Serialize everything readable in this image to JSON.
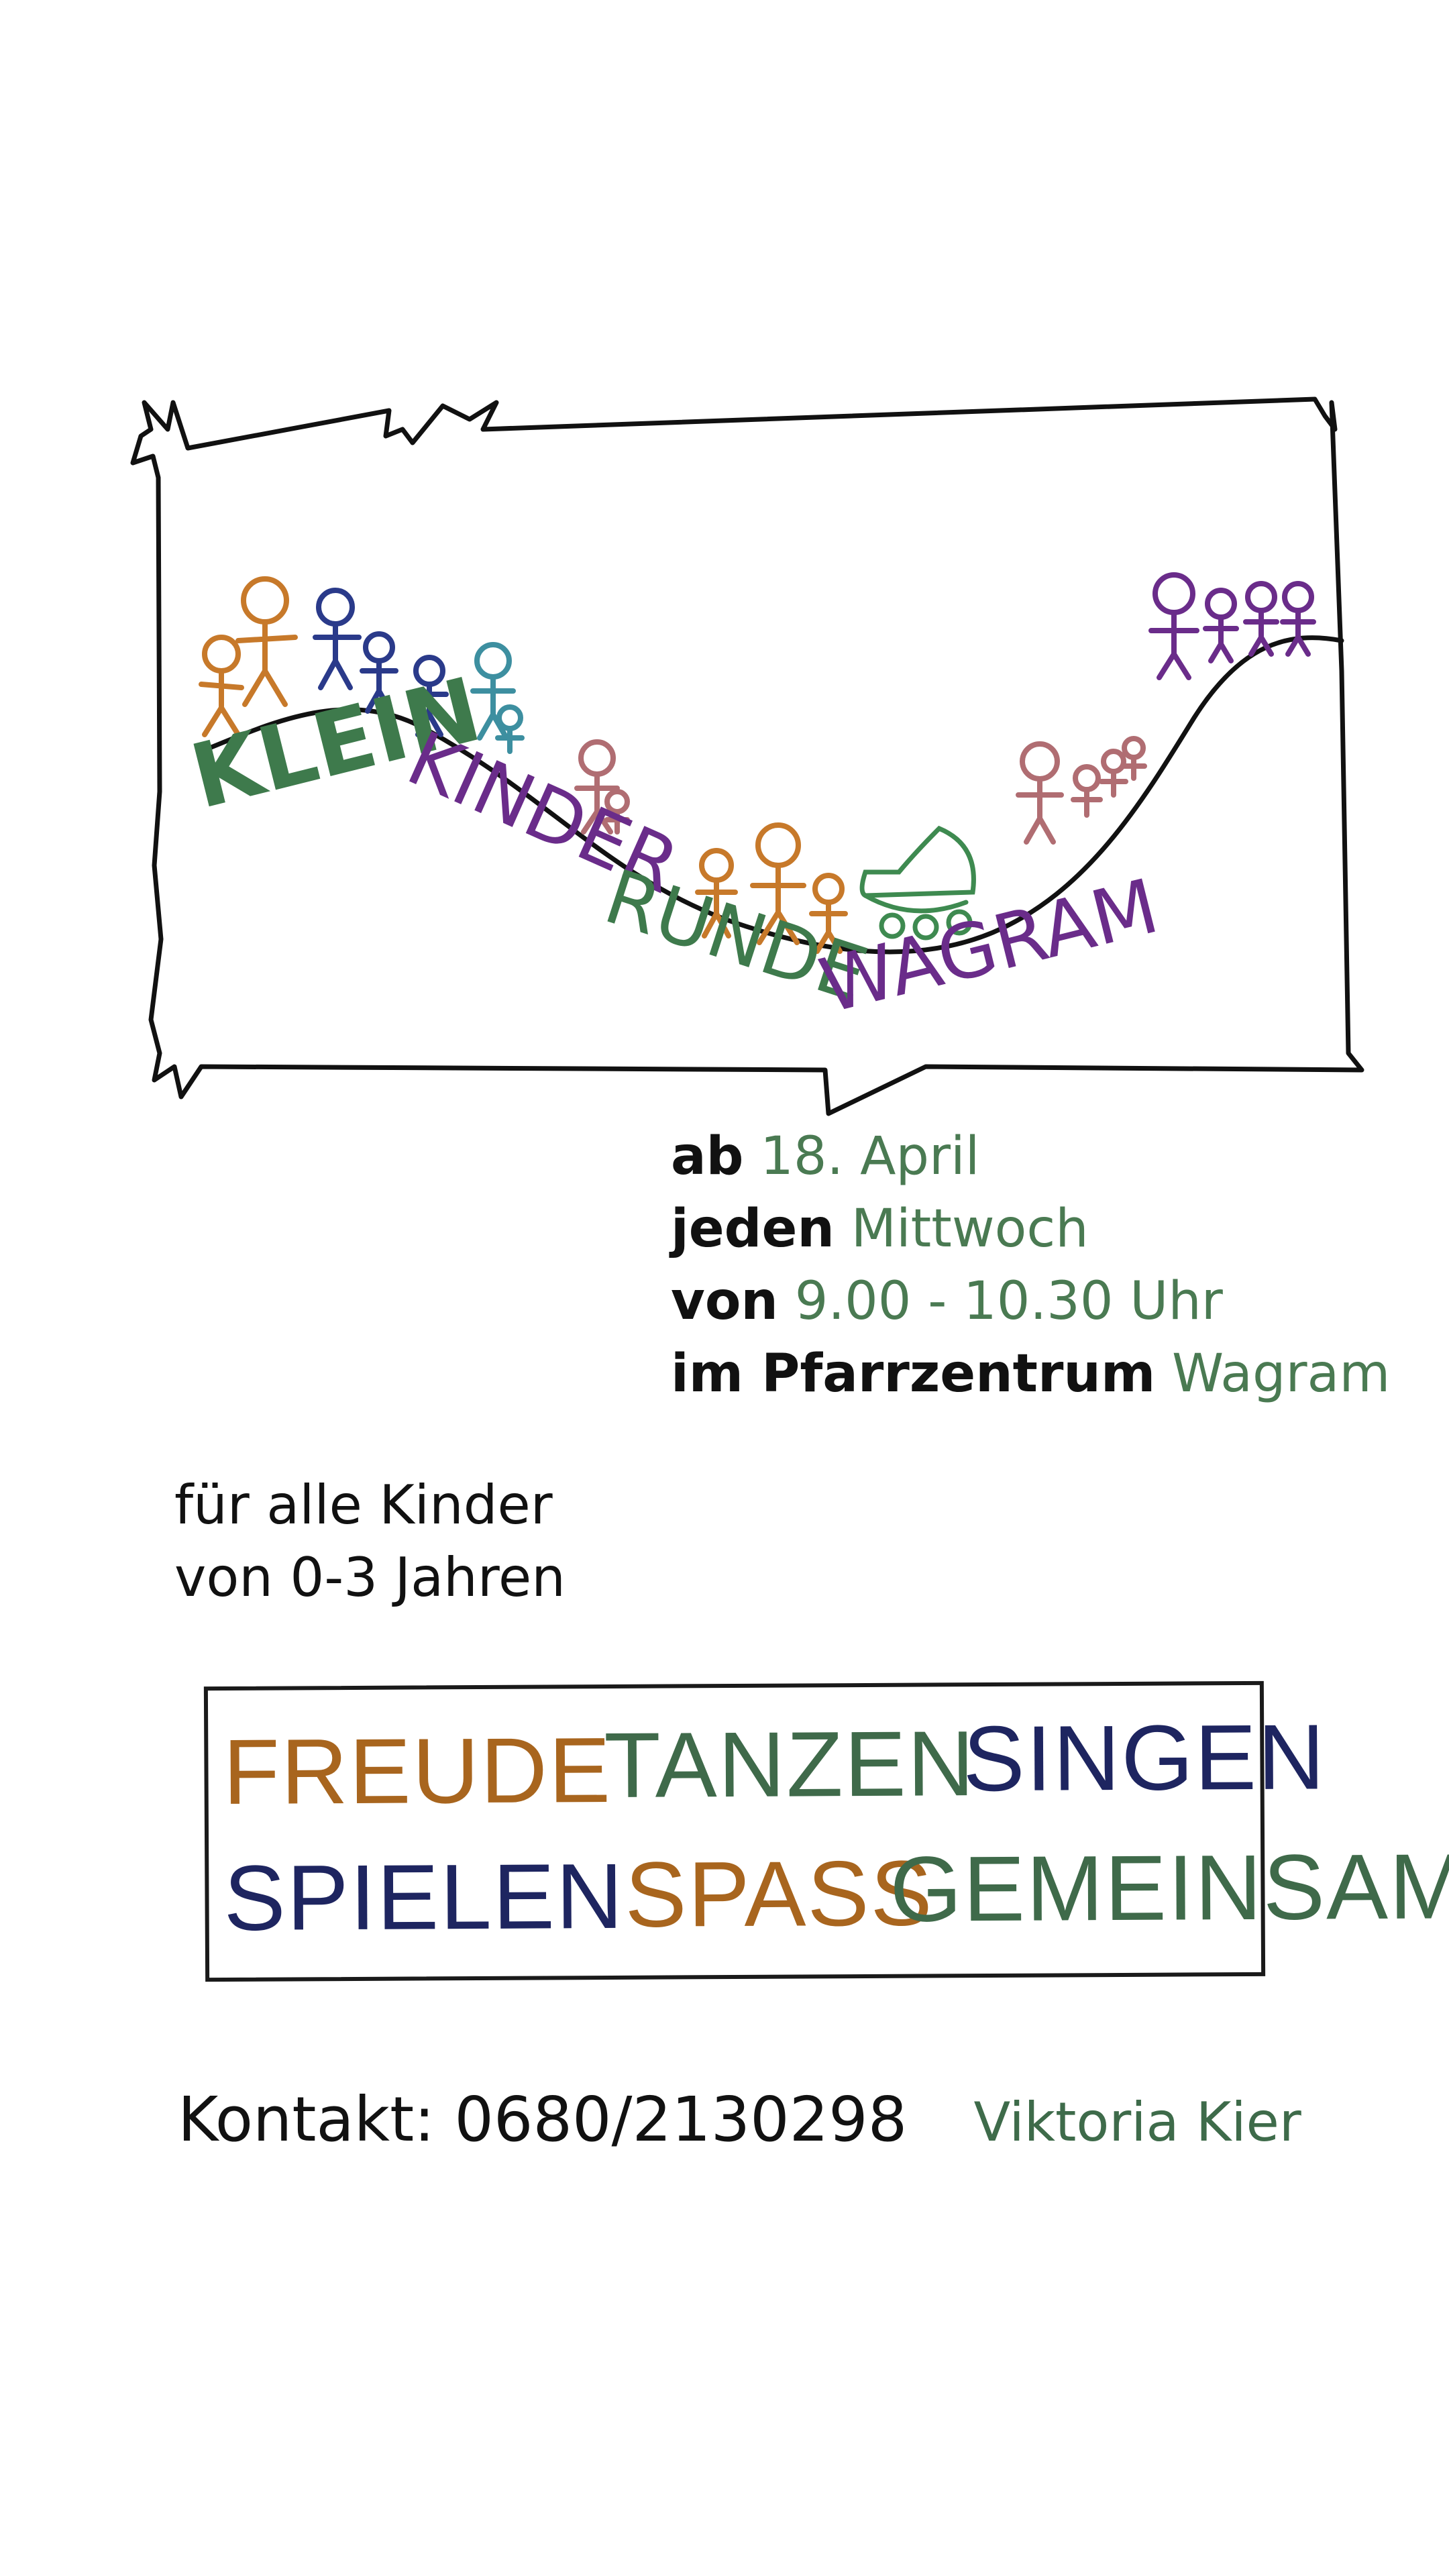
{
  "headline": {
    "part1": "KLEIN",
    "part2": "KINDER",
    "part3": "RUNDE",
    "part4": "WAGRAM"
  },
  "info": {
    "start_key": "ab",
    "start_value": "18. April",
    "day_key": "jeden",
    "day_value": "Mittwoch",
    "time_key": "von",
    "time_value": "9.00 - 10.30 Uhr",
    "place_key": "im Pfarrzentrum",
    "place_value": "Wagram"
  },
  "audience": {
    "line1": "für alle Kinder",
    "line2": "von 0-3 Jahren"
  },
  "words": {
    "freude": "FREUDE",
    "tanzen": "TANZEN",
    "singen": "SINGEN",
    "spielen": "SPIELEN",
    "spass": "SPASS",
    "gemeinsam": "GEMEINSAM"
  },
  "contact": {
    "label": "Kontakt: 0680/2130298",
    "name": "Viktoria Kier"
  },
  "colors": {
    "green": "#3e7a4c",
    "purple": "#6a2c8a",
    "brown": "#a8651e",
    "navy": "#1e2560",
    "orange": "#c7792a",
    "blue": "#2a3a8a",
    "teal": "#3d8fa0",
    "rose": "#b06d72"
  }
}
